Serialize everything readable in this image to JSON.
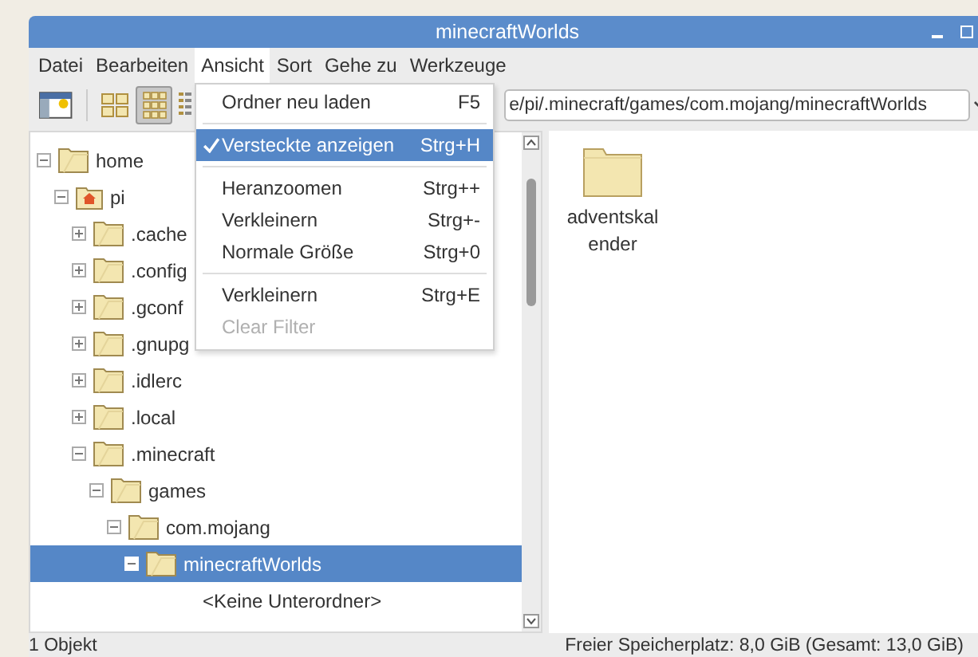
{
  "window": {
    "title": "minecraftWorlds"
  },
  "menubar": [
    {
      "label": "Datei",
      "selected": false
    },
    {
      "label": "Bearbeiten",
      "selected": false
    },
    {
      "label": "Ansicht",
      "selected": true
    },
    {
      "label": "Sort",
      "selected": false
    },
    {
      "label": "Gehe zu",
      "selected": false
    },
    {
      "label": "Werkzeuge",
      "selected": false
    }
  ],
  "toolbar": {
    "view_buttons": [
      {
        "kind": "icons",
        "selected": false
      },
      {
        "kind": "thumbnails",
        "selected": true
      },
      {
        "kind": "list",
        "selected": false
      }
    ],
    "path": "e/pi/.minecraft/games/com.mojang/minecraftWorlds"
  },
  "menu": [
    {
      "kind": "item",
      "label": "Ordner neu laden",
      "shortcut": "F5",
      "checked": false,
      "selected": false,
      "disabled": false
    },
    {
      "kind": "separator"
    },
    {
      "kind": "item",
      "label": "Versteckte anzeigen",
      "shortcut": "Strg+H",
      "checked": true,
      "selected": true,
      "disabled": false
    },
    {
      "kind": "separator"
    },
    {
      "kind": "item",
      "label": "Heranzoomen",
      "shortcut": "Strg++",
      "checked": false,
      "selected": false,
      "disabled": false
    },
    {
      "kind": "item",
      "label": "Verkleinern",
      "shortcut": "Strg+-",
      "checked": false,
      "selected": false,
      "disabled": false
    },
    {
      "kind": "item",
      "label": "Normale Größe",
      "shortcut": "Strg+0",
      "checked": false,
      "selected": false,
      "disabled": false
    },
    {
      "kind": "separator"
    },
    {
      "kind": "item",
      "label": "Verkleinern",
      "shortcut": "Strg+E",
      "checked": false,
      "selected": false,
      "disabled": false
    },
    {
      "kind": "item",
      "label": "Clear Filter",
      "checked": false,
      "selected": false,
      "disabled": true
    }
  ],
  "tree": [
    {
      "kind": "folder",
      "label": "home",
      "expanded": true,
      "selected": false,
      "children": [
        {
          "kind": "home",
          "label": "pi",
          "expanded": true,
          "selected": false,
          "children": [
            {
              "kind": "folder",
              "label": ".cache",
              "expanded": false,
              "selected": false
            },
            {
              "kind": "folder",
              "label": ".config",
              "expanded": false,
              "selected": false
            },
            {
              "kind": "folder",
              "label": ".gconf",
              "expanded": false,
              "selected": false
            },
            {
              "kind": "folder",
              "label": ".gnupg",
              "expanded": false,
              "selected": false
            },
            {
              "kind": "folder",
              "label": ".idlerc",
              "expanded": false,
              "selected": false
            },
            {
              "kind": "folder",
              "label": ".local",
              "expanded": false,
              "selected": false
            },
            {
              "kind": "folder",
              "label": ".minecraft",
              "expanded": true,
              "selected": false,
              "children": [
                {
                  "kind": "folder",
                  "label": "games",
                  "expanded": true,
                  "selected": false,
                  "children": [
                    {
                      "kind": "folder",
                      "label": "com.mojang",
                      "expanded": true,
                      "selected": false,
                      "children": [
                        {
                          "kind": "folder",
                          "label": "minecraftWorlds",
                          "expanded": true,
                          "selected": true,
                          "children": [
                            {
                              "kind": "empty",
                              "label": "<Keine Unterordner>"
                            }
                          ]
                        }
                      ]
                    }
                  ]
                }
              ]
            }
          ]
        }
      ]
    }
  ],
  "files": [
    {
      "label": "adventskalender"
    }
  ],
  "status_bar": {
    "left": "1 Objekt",
    "right": "Freier Speicherplatz: 8,0 GiB (Gesamt: 13,0 GiB)"
  }
}
